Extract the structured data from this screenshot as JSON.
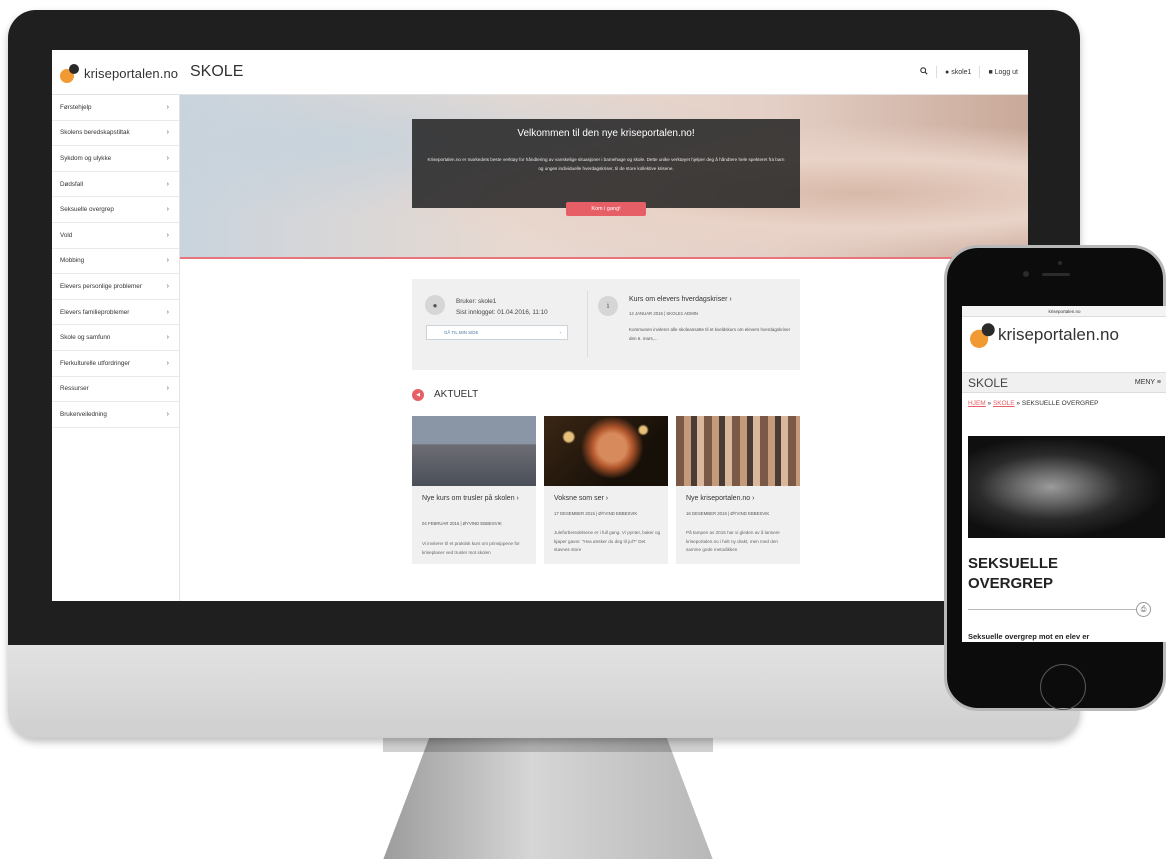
{
  "desktop": {
    "logo_text": "kriseportalen.no",
    "section_title": "SKOLE",
    "header": {
      "user": "skole1",
      "logout": "Logg ut"
    },
    "sidebar": {
      "items": [
        {
          "label": "Førstehjelp"
        },
        {
          "label": "Skolens beredskapstiltak"
        },
        {
          "label": "Sykdom og ulykke"
        },
        {
          "label": "Dødsfall"
        },
        {
          "label": "Seksuelle overgrep"
        },
        {
          "label": "Vold"
        },
        {
          "label": "Mobbing"
        },
        {
          "label": "Elevers personlige problemer"
        },
        {
          "label": "Elevers familieproblemer"
        },
        {
          "label": "Skole og samfunn"
        },
        {
          "label": "Flerkulturelle utfordringer"
        },
        {
          "label": "Ressurser"
        },
        {
          "label": "Brukerveiledning"
        }
      ]
    },
    "hero": {
      "title": "Velkommen til den nye kriseportalen.no!",
      "text": "Kriseportalen.no er markedets beste verktøy for håndtering av vanskelige situasjoner i barnehage og skole. Dette unike verktøyet hjelper deg å håndtere hele spekteret fra barn og unges individuelle hverdagskriser, til de store kollektive krisene.",
      "cta": "Kom i gang!"
    },
    "info": {
      "user_line": "Bruker: skole1",
      "last_login": "Sist innlogget: 01.04.2016, 11:10",
      "my_page_button": "GÅ TIL MIN SIDE",
      "course_title": "Kurs om elevers hverdagskriser",
      "course_meta": "14 JANUAR 2016 | SKOLE1 ADMIN",
      "course_text": "Kommunen inviterer alle skoleansatte til et kveldskurs om elevers hverdagskriser den 6. mars,..."
    },
    "aktuelt": {
      "title": "AKTUELT",
      "cards": [
        {
          "title": "Nye kurs om trusler på skolen",
          "meta": "04 FEBRUAR 2016 | ØYVIND EBBESVIK",
          "text": "Vi inviterer til et praktisk kurs om prinsippene for kriseplaner ved trusler mot skolen"
        },
        {
          "title": "Voksne som ser",
          "meta": "17 DESEMBER 2015 | ØYVIND EBBESVIK",
          "text": "Juleforberedelsene er i full gang. Vi pynter, baker og kjøper gaver. \"Hva ønsker du deg til jul?\" Det stavnes store"
        },
        {
          "title": "Nye kriseportalen.no",
          "meta": "16 DESEMBER 2015 | ØYVIND EBBESVIK",
          "text": "På tampen av 2015 har vi gleden av å lansere kriseportalen.no i helt ny drakt, men med den samme gode metodikken"
        }
      ]
    }
  },
  "mobile": {
    "url": "kriseportalen.no",
    "logo_text": "kriseportalen.no",
    "section": "SKOLE",
    "menu": "MENY ≡",
    "breadcrumb": {
      "home": "HJEM",
      "sep1": " » ",
      "section": "SKOLE",
      "sep2": " » ",
      "current": "SEKSUELLE OVERGREP"
    },
    "title_line1": "SEKSUELLE",
    "title_line2": "OVERGREP",
    "intro": "Seksuelle overgrep mot en elev er"
  },
  "icons": {
    "search": "search-icon",
    "user": "user-icon",
    "lock": "lock-icon",
    "info": "info-icon",
    "megaphone": "megaphone-icon",
    "print": "print-icon"
  },
  "colors": {
    "accent": "#e75f66",
    "logo_orange": "#f19a33"
  }
}
